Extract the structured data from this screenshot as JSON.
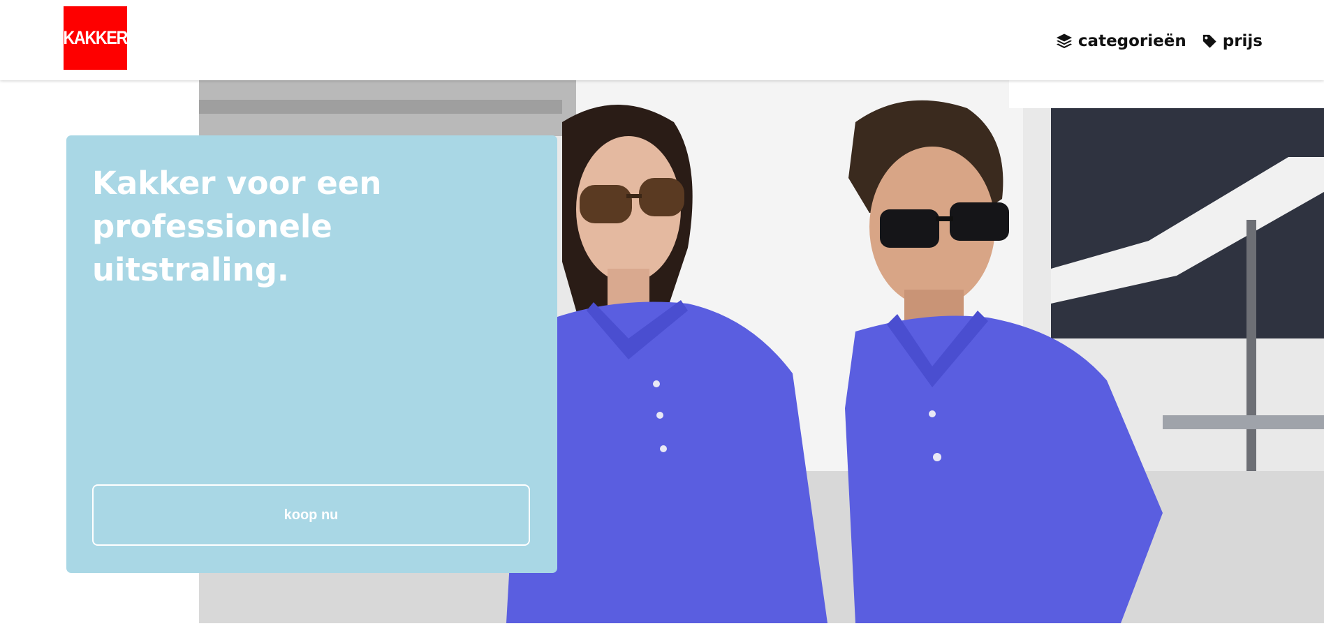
{
  "brand": {
    "logo_text": "KAKKER",
    "logo_color": "#fe0000"
  },
  "nav": {
    "items": [
      {
        "label": "categorieën",
        "icon": "layers-icon"
      },
      {
        "label": "prijs",
        "icon": "tag-icon"
      }
    ]
  },
  "hero": {
    "title": "Kakker voor een professionele uitstraling.",
    "cta_label": "koop nu",
    "card_color": "#a9d7e5",
    "shirt_color": "#5a5ee0"
  }
}
